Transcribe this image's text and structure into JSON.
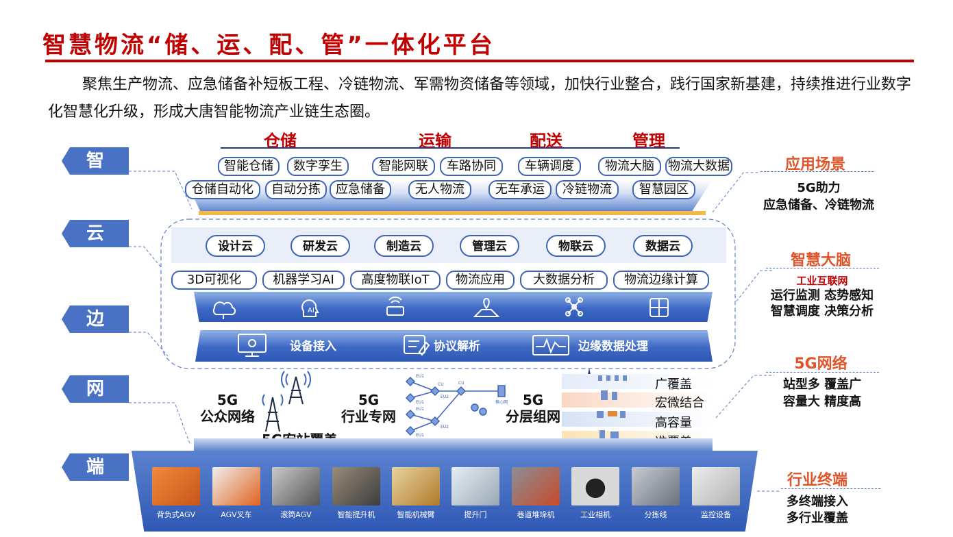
{
  "title": "智慧物流“储、运、配、管”一体化平台",
  "intro": "聚焦生产物流、应急储备补短板工程、冷链物流、军需物资储备等领域，加快行业整合，践行国家新基建，持续推进行业数字化智慧化升级，形成大唐智能物流产业链生态圈。",
  "layers": [
    "智",
    "云",
    "边",
    "网",
    "端"
  ],
  "categories": [
    "仓储",
    "运输",
    "配送",
    "管理"
  ],
  "app_pills": {
    "row1": [
      "智能仓储",
      "数字孪生",
      "智能网联",
      "车路协同",
      "车辆调度",
      "物流大脑",
      "物流大数据"
    ],
    "row2": [
      "仓储自动化",
      "自动分拣",
      "应急储备",
      "无人物流",
      "无车承运",
      "冷链物流",
      "智慧园区"
    ]
  },
  "clouds": [
    "设计云",
    "研发云",
    "制造云",
    "管理云",
    "物联云",
    "数据云"
  ],
  "cloud_capabilities": [
    "3D可视化",
    "机器学习AI",
    "高度物联IoT",
    "物流应用",
    "大数据分析",
    "物流边缘计算"
  ],
  "edge_functions": [
    "设备接入",
    "协议解析",
    "边缘数据处理"
  ],
  "network": {
    "public": [
      "5G",
      "公众网络"
    ],
    "macro": "5G宏站覆盖",
    "private": [
      "5G",
      "行业专网"
    ],
    "layered": [
      "5G",
      "分层组网"
    ],
    "coverage": [
      "广覆盖",
      "宏微结合",
      "高容量",
      "准覆盖"
    ],
    "topology_labels": [
      "EU1",
      "EU1",
      "EU1",
      "EU1",
      "CU",
      "EU2",
      "EU2",
      "CU",
      "核心网"
    ]
  },
  "terminals": [
    "背负式AGV",
    "AGV叉车",
    "滚筒AGV",
    "智能提升机",
    "智能机械臂",
    "提升门",
    "巷道堆垛机",
    "工业相机",
    "分拣线",
    "监控设备"
  ],
  "side": {
    "app": {
      "heading": "应用场景",
      "lines": [
        "5G助力",
        "应急储备、冷链物流"
      ]
    },
    "brain": {
      "heading": "智慧大脑",
      "sub": "工业互联网",
      "lines": [
        "运行监测  态势感知",
        "智慧调度  决策分析"
      ]
    },
    "net": {
      "heading": "5G网络",
      "lines": [
        "站型多  覆盖广",
        "容量大  精度高"
      ]
    },
    "term": {
      "heading": "行业终端",
      "lines": [
        "多终端接入",
        "多行业覆盖"
      ]
    }
  },
  "colors": {
    "accent": "#c00000",
    "layer_blue": "#4a72c4",
    "side_heading": "#e0552a"
  }
}
